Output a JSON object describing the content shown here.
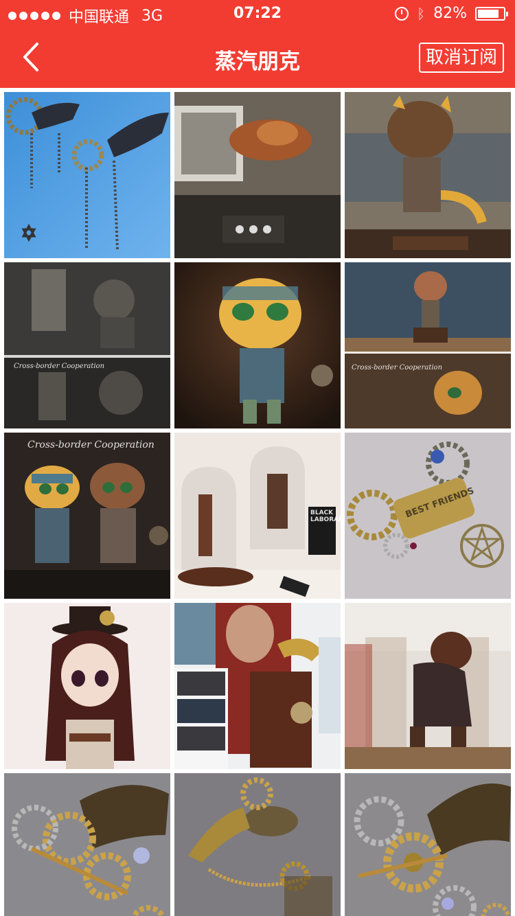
{
  "status_bar": {
    "carrier": "中国联通",
    "network": "3G",
    "time": "07:22",
    "battery": "82%",
    "battery_level": 0.82
  },
  "nav": {
    "title": "蒸汽朋克",
    "unsubscribe_label": "取消订阅"
  },
  "photos": [
    {
      "subject": "wing-gear brooches on blue cloth"
    },
    {
      "subject": "copper steampunk sculpture on desk"
    },
    {
      "subject": "steampunk cat figure back view"
    },
    {
      "subject": "metallic figure with machinery",
      "caption": "Cross-border Cooperation"
    },
    {
      "subject": "yellow steampunk cat figure"
    },
    {
      "subject": "steampunk cat figure with helmet",
      "caption": "Cross-border Cooperation"
    },
    {
      "subject": "two steampunk cat figures",
      "caption": "Cross-border Cooperation"
    },
    {
      "subject": "figures under glass domes",
      "caption": "BLACK LABORARY"
    },
    {
      "subject": "BEST FRIENDS gear pendants",
      "caption": "BEST FRIENDS"
    },
    {
      "subject": "doll with top hat"
    },
    {
      "subject": "movie poster and bird sculpture on box"
    },
    {
      "subject": "figure in glass jar"
    },
    {
      "subject": "golden wing gear brooch"
    },
    {
      "subject": "bird skull gear necklace"
    },
    {
      "subject": "wing gear brooch with crystals"
    }
  ]
}
